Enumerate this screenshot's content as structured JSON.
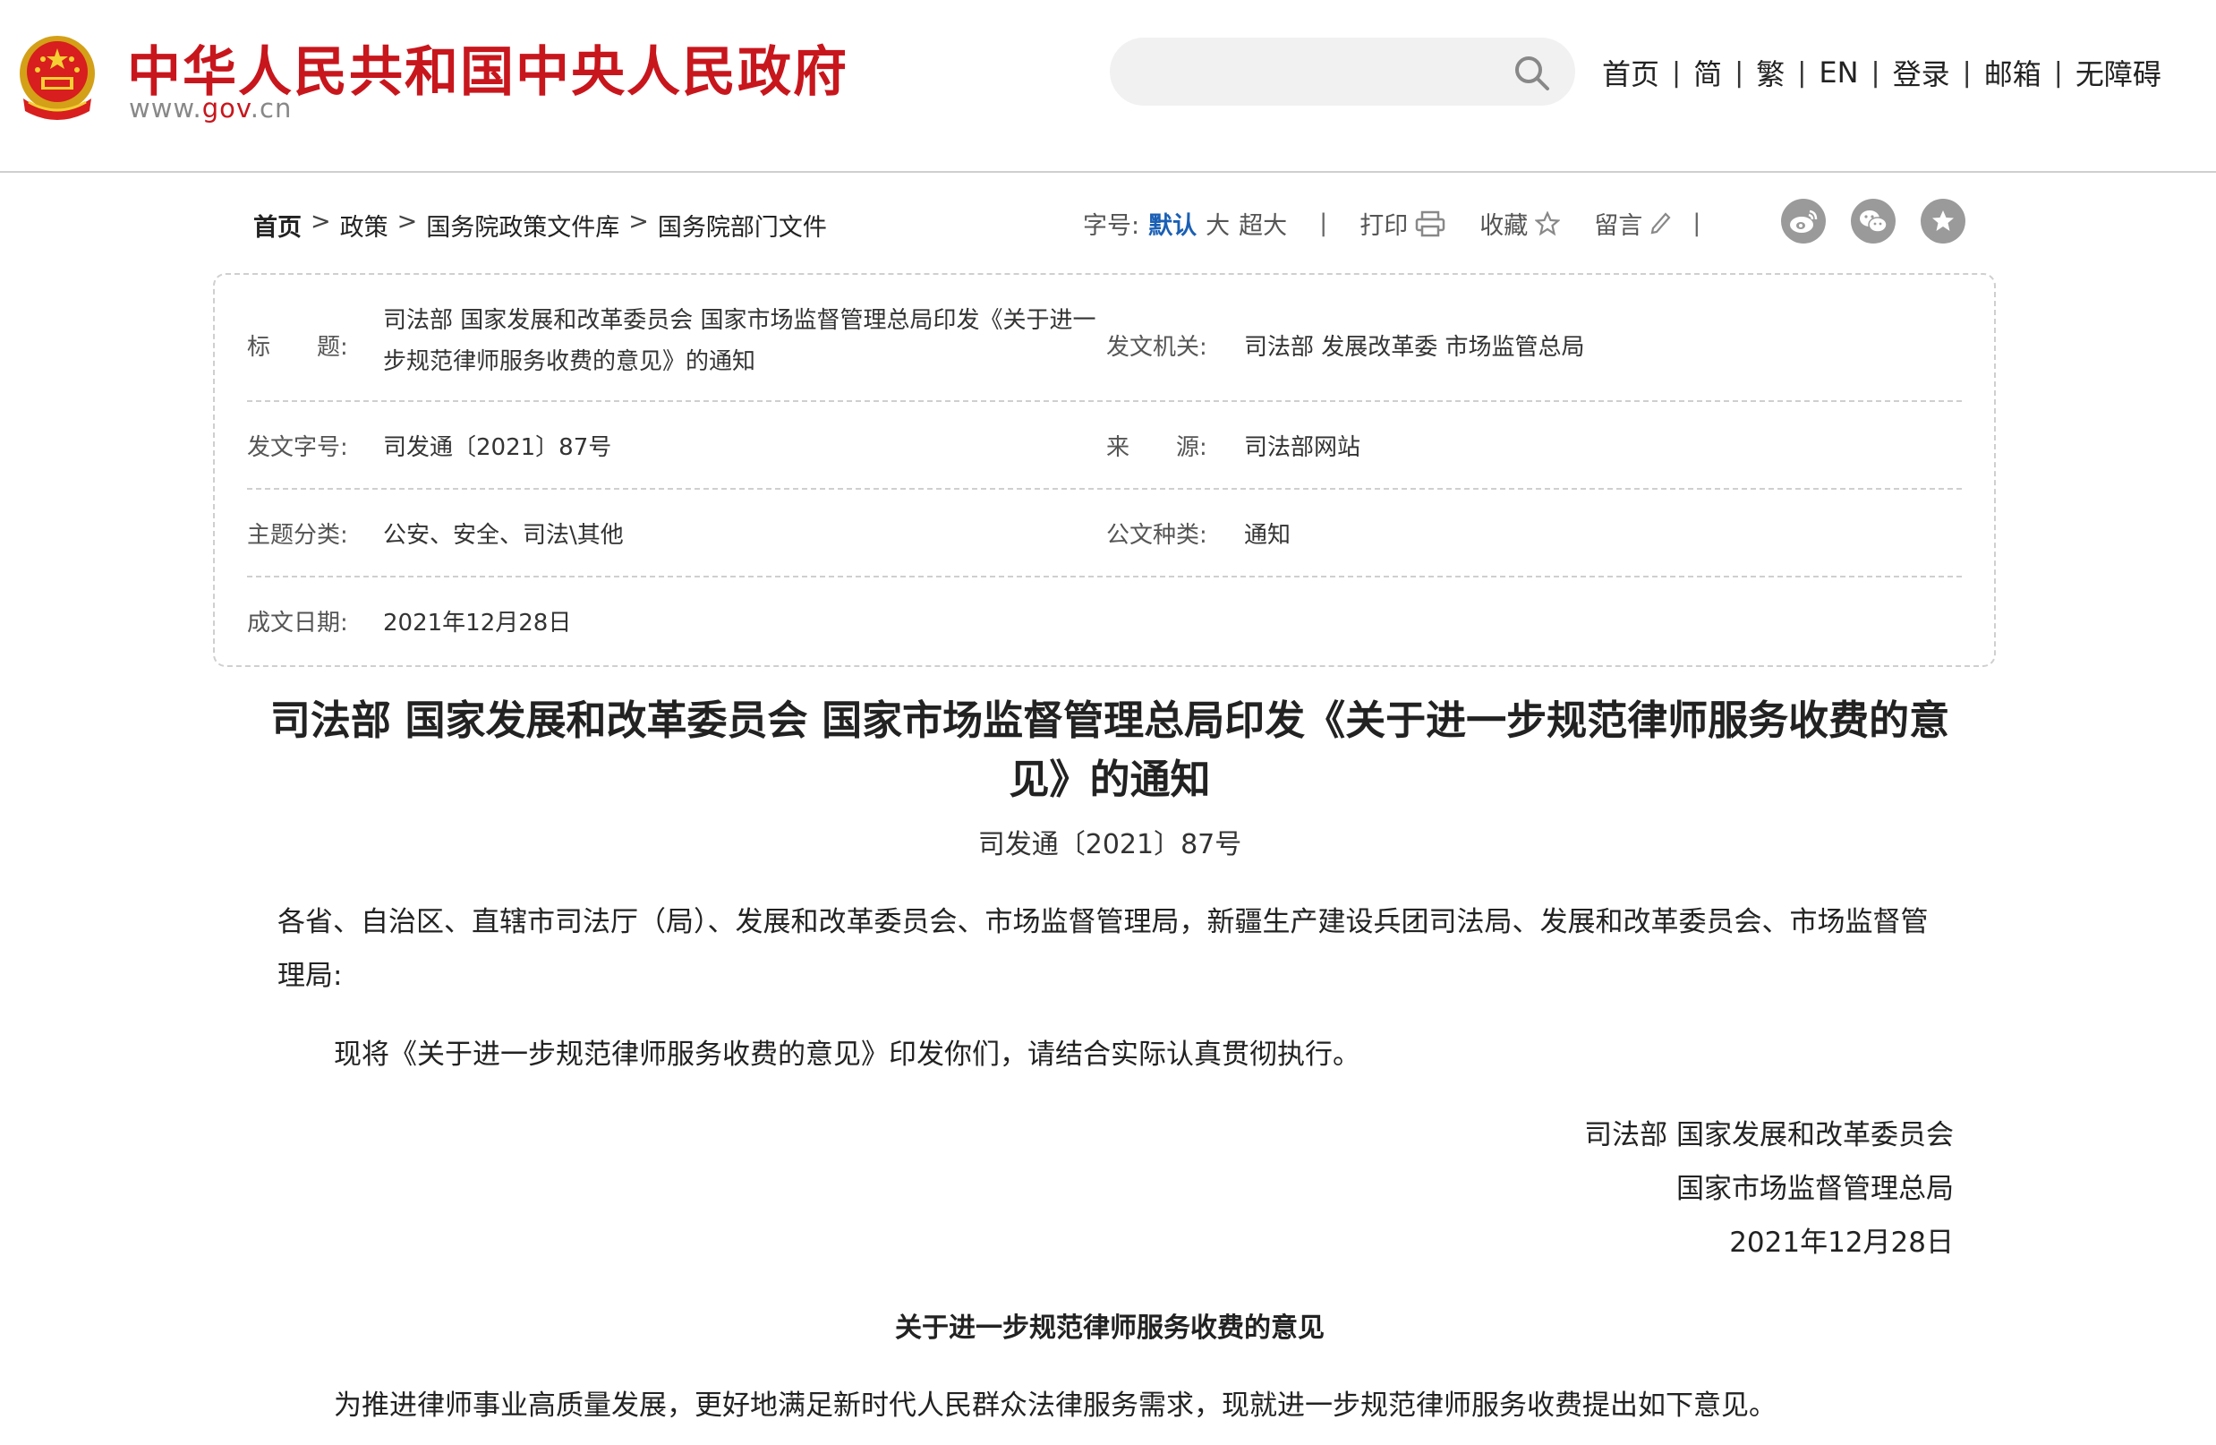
{
  "header": {
    "site_title": "中华人民共和国中央人民政府",
    "site_url_prefix": "www.",
    "site_url_gov": "gov",
    "site_url_suffix": ".cn",
    "search_placeholder": "",
    "nav": [
      "首页",
      "简",
      "繁",
      "EN",
      "登录",
      "邮箱",
      "无障碍"
    ],
    "nav_separator": "|"
  },
  "breadcrumb": {
    "items": [
      "首页",
      "政策",
      "国务院政策文件库",
      "国务院部门文件"
    ],
    "separator": ">"
  },
  "tools": {
    "font_size_label": "字号:",
    "font_sizes": [
      "默认",
      "大",
      "超大"
    ],
    "separator": "|",
    "print": "打印",
    "favorite": "收藏",
    "comment": "留言"
  },
  "info": {
    "title_label": "标　　题:",
    "title_value": "司法部 国家发展和改革委员会 国家市场监督管理总局印发《关于进一步规范律师服务收费的意见》的通知",
    "issuer_label": "发文机关:",
    "issuer_value": "司法部 发展改革委 市场监管总局",
    "doc_no_label": "发文字号:",
    "doc_no_value": "司发通〔2021〕87号",
    "source_label": "来　　源:",
    "source_value": "司法部网站",
    "category_label": "主题分类:",
    "category_value": "公安、安全、司法\\其他",
    "type_label": "公文种类:",
    "type_value": "通知",
    "date_label": "成文日期:",
    "date_value": "2021年12月28日"
  },
  "article": {
    "title": "司法部 国家发展和改革委员会 国家市场监督管理总局印发《关于进一步规范律师服务收费的意见》的通知",
    "doc_no": "司发通〔2021〕87号",
    "addressee": "各省、自治区、直辖市司法厅（局）、发展和改革委员会、市场监督管理局，新疆生产建设兵团司法局、发展和改革委员会、市场监督管理局:",
    "body": "现将《关于进一步规范律师服务收费的意见》印发你们，请结合实际认真贯彻执行。",
    "signature_line1": "司法部 国家发展和改革委员会",
    "signature_line2": "国家市场监督管理总局",
    "signature_date": "2021年12月28日",
    "sub_title": "关于进一步规范律师服务收费的意见",
    "intro": "为推进律师事业高质量发展，更好地满足新时代人民群众法律服务需求，现就进一步规范律师服务收费提出如下意见。"
  },
  "colors": {
    "brand_red": "#c8161d",
    "link_blue": "#1a5fb4",
    "icon_gray": "#9a9a9a"
  }
}
